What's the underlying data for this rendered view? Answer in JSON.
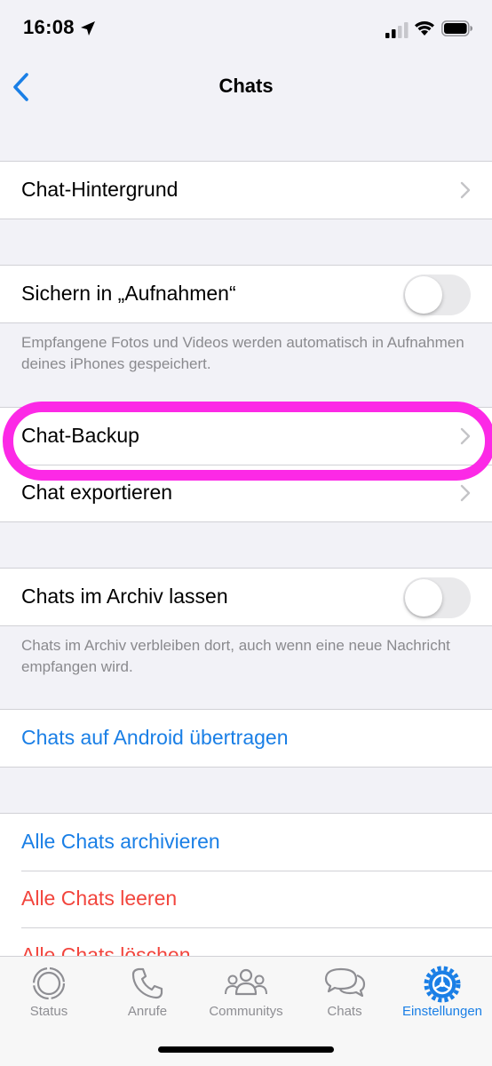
{
  "status_bar": {
    "time": "16:08"
  },
  "nav": {
    "title": "Chats"
  },
  "settings": {
    "chat_wallpaper": "Chat-Hintergrund",
    "save_to_camera_roll": "Sichern in „Aufnahmen“",
    "save_footnote": "Empfangene Fotos und Videos werden automatisch in Aufnahmen deines iPhones gespeichert.",
    "chat_backup": "Chat-Backup",
    "export_chat": "Chat exportieren",
    "keep_archived": "Chats im Archiv lassen",
    "archive_footnote": "Chats im Archiv verbleiben dort, auch wenn eine neue Nachricht empfangen wird.",
    "move_to_android": "Chats auf Android übertragen",
    "archive_all": "Alle Chats archivieren",
    "clear_all": "Alle Chats leeren",
    "delete_all": "Alle Chats löschen"
  },
  "toggles": {
    "save_to_camera_roll": false,
    "keep_archived": false
  },
  "tabs": [
    {
      "label": "Status",
      "icon": "status-icon"
    },
    {
      "label": "Anrufe",
      "icon": "phone-icon"
    },
    {
      "label": "Communitys",
      "icon": "communities-icon"
    },
    {
      "label": "Chats",
      "icon": "chat-bubbles-icon"
    },
    {
      "label": "Einstellungen",
      "icon": "settings-gear-icon",
      "active": true
    }
  ],
  "colors": {
    "accent": "#1a7fe6",
    "destructive": "#f2453d",
    "highlight": "#fc29e6"
  }
}
